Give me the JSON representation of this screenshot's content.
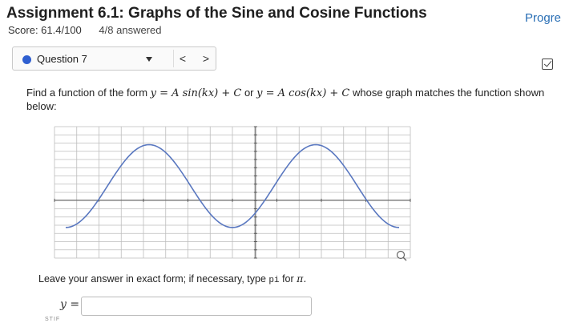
{
  "header": {
    "title": "Assignment 6.1: Graphs of the Sine and Cosine Functions",
    "progress_link": "Progres",
    "score": "Score: 61.4/100",
    "answered": "4/8 answered"
  },
  "question_nav": {
    "label": "Question 7",
    "prev": "<",
    "next": ">"
  },
  "prompt": {
    "part1": "Find a function of the form ",
    "form1": "y = A sin(kx) + C",
    "or": " or ",
    "form2": "y = A cos(kx) + C",
    "part2": " whose graph matches the function shown below:"
  },
  "instructions": {
    "text": "Leave your answer in exact form; if necessary, type ",
    "code": "pi",
    "text2": " for ",
    "pi": "π."
  },
  "answer": {
    "label": "y =",
    "value": ""
  },
  "footer_text": "STIF",
  "colors": {
    "curve": "#5a78c0",
    "grid": "#bdbdbd",
    "title": "#1f1f1f",
    "link": "#2a6fb5",
    "dot": "#2f5fd0"
  },
  "chart_data": {
    "type": "line",
    "title": "",
    "xlabel": "",
    "ylabel": "",
    "description_of_curve": "sinusoid",
    "x_grid_lines": 16,
    "y_grid_lines": 16,
    "series": [
      {
        "values": [
          {
            "x": 0.0,
            "y": -0.7
          },
          {
            "x": 0.25,
            "y": 0.95
          },
          {
            "x": 0.5,
            "y": -0.7
          },
          {
            "x": 0.75,
            "y": 0.95
          },
          {
            "x": 1.0,
            "y": -0.7
          }
        ]
      }
    ],
    "grid": true
  }
}
